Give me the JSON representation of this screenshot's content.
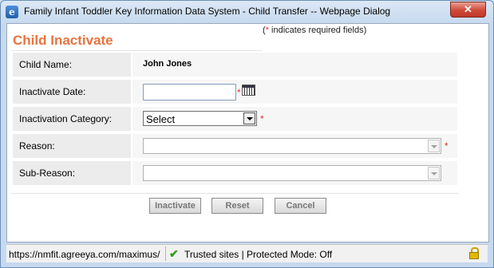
{
  "window": {
    "title": "Family Infant Toddler Key Information Data System - Child Transfer -- Webpage Dialog",
    "close_label": "✕"
  },
  "form": {
    "heading": "Child Inactivate",
    "required_note_star": "*",
    "required_note_text": " indicates required fields)",
    "required_note_open": "(",
    "required_star": "*",
    "fields": {
      "child_name": {
        "label": "Child Name:",
        "value": "John Jones"
      },
      "inactivate_date": {
        "label": "Inactivate Date:",
        "value": ""
      },
      "inactivation_category": {
        "label": "Inactivation Category:",
        "selected": "Select"
      },
      "reason": {
        "label": "Reason:",
        "selected": ""
      },
      "sub_reason": {
        "label": "Sub-Reason:",
        "selected": ""
      }
    },
    "buttons": {
      "inactivate": "Inactivate",
      "reset": "Reset",
      "cancel": "Cancel"
    }
  },
  "status_bar": {
    "url": "https://nmfit.agreeya.com/maximus/",
    "zone": "Trusted sites | Protected Mode: Off"
  },
  "icons": {
    "app": "ie-page-icon",
    "calendar": "calendar-icon",
    "trusted": "checkmark-icon",
    "lock": "padlock-icon"
  },
  "colors": {
    "heading": "#e8733f",
    "required": "#e03030"
  }
}
